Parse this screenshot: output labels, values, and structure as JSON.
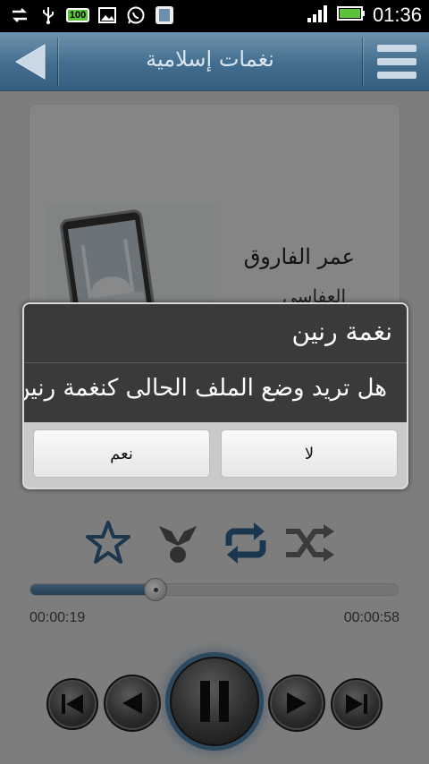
{
  "status_bar": {
    "time": "01:36",
    "battery_badge": "100",
    "icons": [
      "sync-icon",
      "usb-icon",
      "battery-badge-icon",
      "gallery-icon",
      "whatsapp-icon",
      "app-icon",
      "signal-icon",
      "battery-icon"
    ]
  },
  "app_bar": {
    "title": "نغمات إسلامية",
    "back_icon": "back-arrow-icon",
    "menu_icon": "menu-icon"
  },
  "now_playing": {
    "reciter_line1": "عمر الفاروق",
    "reciter_line2": "العفاسي"
  },
  "player": {
    "current_time": "00:00:19",
    "total_time": "00:00:58",
    "progress": 0.34,
    "controls": [
      "star-icon",
      "share-icon",
      "repeat-icon",
      "shuffle-icon"
    ],
    "transport": [
      "skip-previous-icon",
      "rewind-icon",
      "pause-icon",
      "fast-forward-icon",
      "skip-next-icon"
    ]
  },
  "dialog": {
    "title": "نغمة رنين",
    "message": "هل تريد وضع الملف الحالى كنغمة رنين",
    "yes_label": "نعم",
    "no_label": "لا"
  },
  "colors": {
    "accent": "#3f6f97",
    "app_bar": "#426d8f",
    "dialog_dark": "#3a3a3a"
  }
}
